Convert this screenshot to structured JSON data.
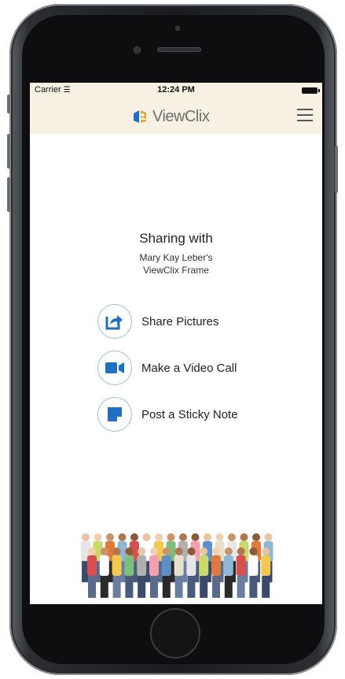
{
  "status_bar": {
    "carrier": "Carrier",
    "time": "12:24 PM"
  },
  "header": {
    "app_name": "ViewClix"
  },
  "sharing": {
    "title": "Sharing with",
    "recipient_line1": "Mary Kay Leber's",
    "recipient_line2": "ViewClix Frame"
  },
  "actions": [
    {
      "label": "Share Pictures",
      "icon": "share-icon"
    },
    {
      "label": "Make a Video Call",
      "icon": "video-camera-icon"
    },
    {
      "label": "Post a Sticky Note",
      "icon": "sticky-note-icon"
    }
  ],
  "colors": {
    "accent": "#1f6fc5",
    "header_bg": "#f6f1e2",
    "circle_border": "#9bbde2"
  }
}
